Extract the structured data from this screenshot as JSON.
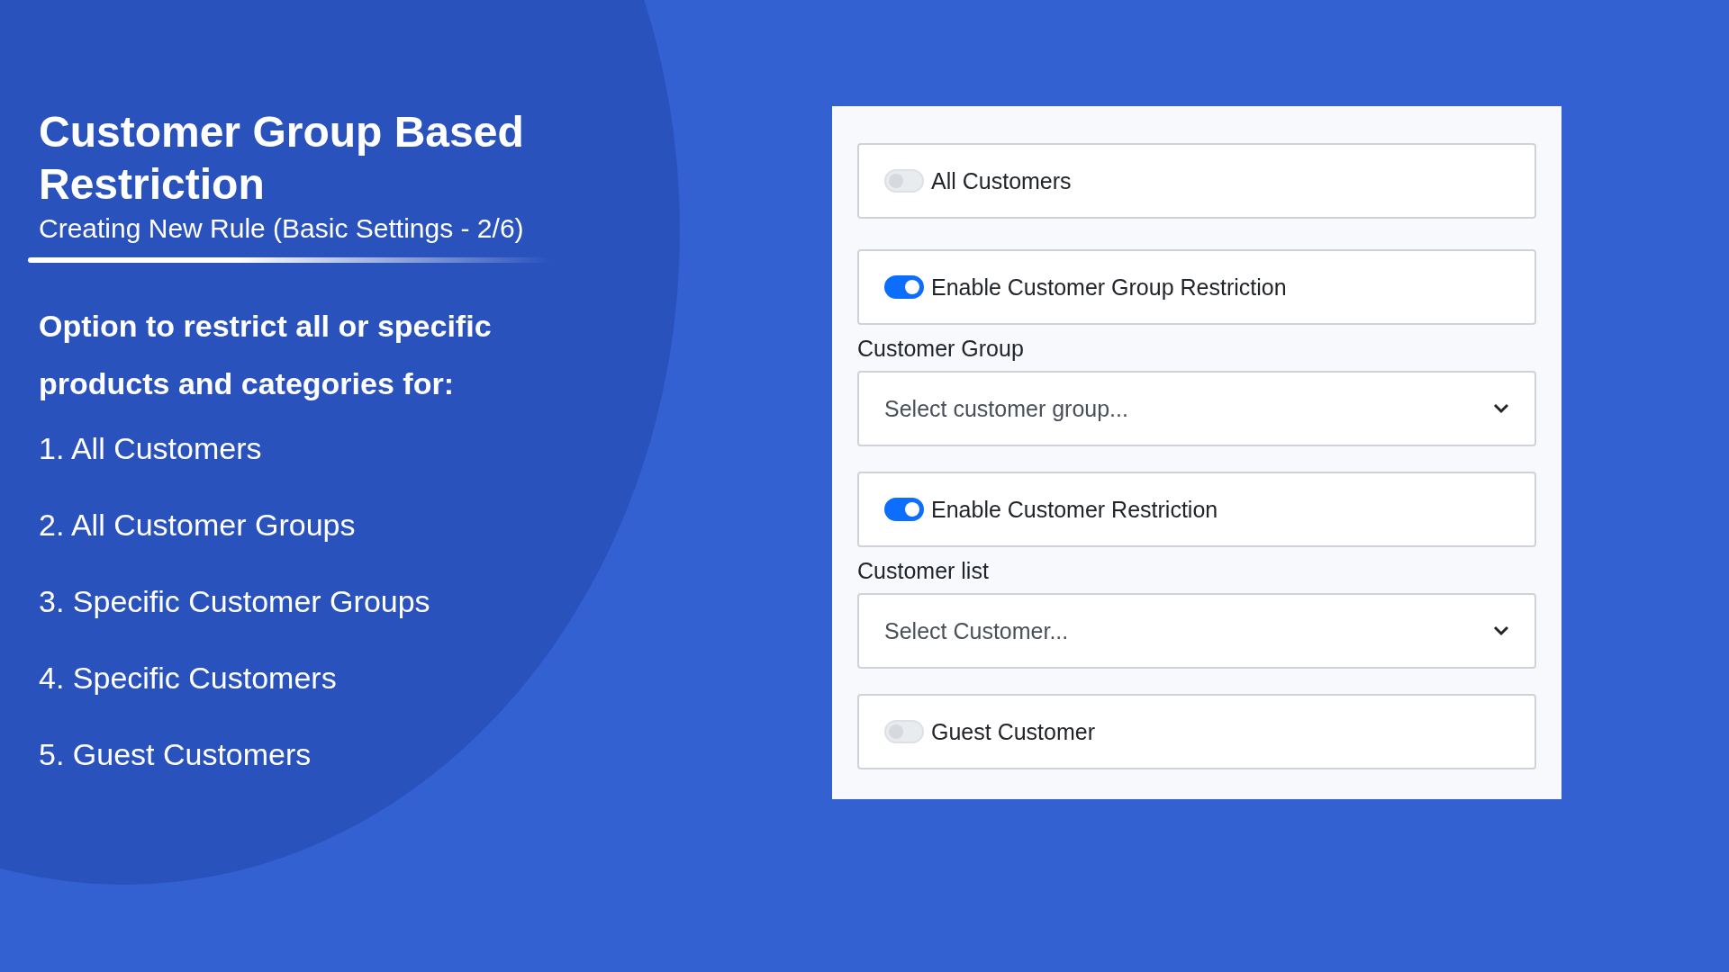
{
  "slide": {
    "title": "Customer Group Based Restriction",
    "subtitle": "Creating New Rule (Basic Settings - 2/6)",
    "intro": "Option to restrict all or specific products and categories for:",
    "options": [
      "1. All Customers",
      "2. All Customer Groups",
      "3. Specific Customer Groups",
      "4. Specific Customers",
      "5. Guest Customers"
    ]
  },
  "form": {
    "fields": [
      {
        "kind": "toggle",
        "label": "All Customers",
        "on": false
      },
      {
        "kind": "toggle",
        "label": "Enable Customer Group Restriction",
        "on": true
      },
      {
        "kind": "select",
        "label": "Customer Group",
        "placeholder": "Select customer group..."
      },
      {
        "kind": "toggle",
        "label": "Enable Customer Restriction",
        "on": true
      },
      {
        "kind": "select",
        "label": "Customer list",
        "placeholder": "Select Customer..."
      },
      {
        "kind": "toggle",
        "label": "Guest Customer",
        "on": false
      }
    ]
  }
}
